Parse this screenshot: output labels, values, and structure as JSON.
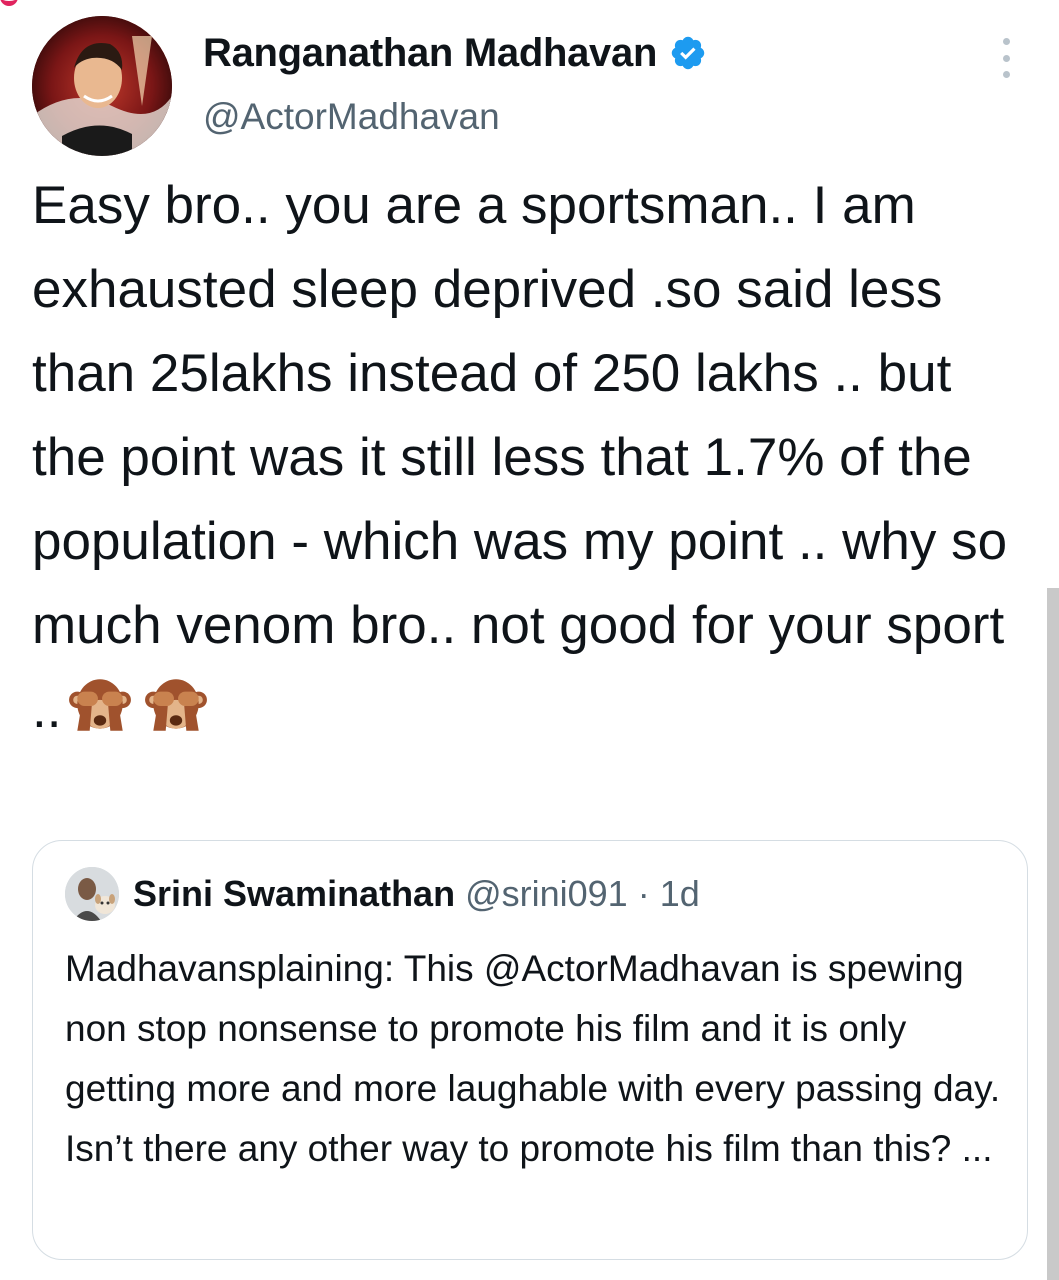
{
  "tweet": {
    "display_name": "Ranganathan Madhavan",
    "handle": "@ActorMadhavan",
    "text": "Easy bro.. you are a sportsman.. I am exhausted sleep deprived .so said less than 25lakhs instead of 250 lakhs .. but the point was it still less that 1.7% of the population - which was my point .. why so much venom bro.. not good for your sport ..",
    "emojis": [
      "see-no-evil-monkey",
      "see-no-evil-monkey"
    ],
    "verified_icon": "verified-badge-icon",
    "menu_icon": "more-vertical-icon"
  },
  "quoted_tweet": {
    "display_name": "Srini Swaminathan",
    "handle": "@srini091",
    "separator": "·",
    "time": "1d",
    "text": "Madhavansplaining: This @ActorMadhavan is spewing non stop nonsense to promote his film and it is only getting more and more laughable with every passing day. Isn’t there any other way to promote his film than this? ..."
  },
  "colors": {
    "text_primary": "#0f1419",
    "text_secondary": "#536471",
    "verified_blue": "#1d9bf0",
    "card_border": "#d5dde3"
  }
}
